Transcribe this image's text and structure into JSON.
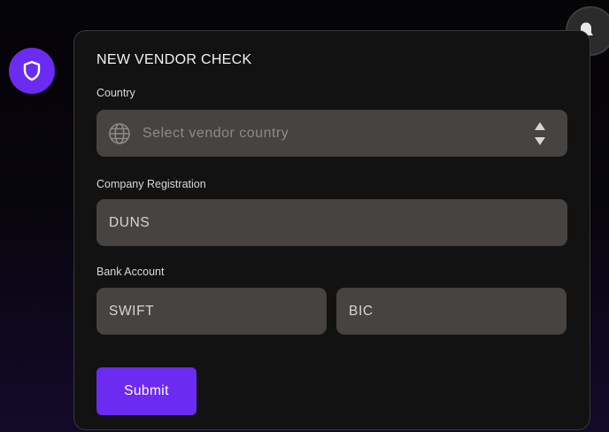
{
  "form": {
    "title": "NEW VENDOR CHECK",
    "country_label": "Country",
    "country_placeholder": "Select vendor country",
    "registration_label": "Company Registration",
    "duns_placeholder": "DUNS",
    "bank_label": "Bank Account",
    "swift_placeholder": "SWIFT",
    "bic_placeholder": "BIC",
    "submit_label": "Submit"
  },
  "icons": {
    "brand": "shield-icon",
    "notifications": "bell-icon",
    "country": "globe-icon",
    "select_arrows": "up-down-arrows-icon"
  },
  "colors": {
    "accent": "#6c2bf0",
    "panel": "#121212",
    "field": "#464340"
  }
}
